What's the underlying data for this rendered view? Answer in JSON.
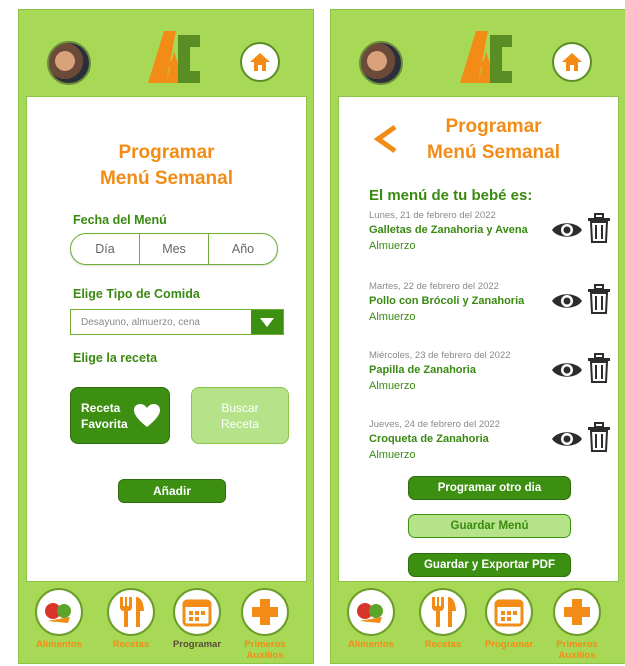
{
  "left_screen": {
    "title_line1": "Programar",
    "title_line2": "Menú Semanal",
    "date_label": "Fecha del Menú",
    "date_fields": [
      "Día",
      "Mes",
      "Año"
    ],
    "meal_type_label": "Elige Tipo de Comida",
    "meal_type_placeholder": "Desayuno, almuerzo, cena",
    "recipe_label": "Elige la receta",
    "favorite_button": "Receta Favorita",
    "search_button_line1": "Buscar",
    "search_button_line2": "Receta",
    "add_button": "Añadir"
  },
  "right_screen": {
    "title_line1": "Programar",
    "title_line2": "Menú Semanal",
    "menu_heading": "El menú de tu bebé es:",
    "meals": [
      {
        "date": "Lunes, 21 de febrero del 2022",
        "name": "Galletas de Zanahoria y Avena",
        "type": "Almuerzo"
      },
      {
        "date": "Martes, 22 de febrero del 2022",
        "name": "Pollo con Brócoli y Zanahoria",
        "type": "Almuerzo"
      },
      {
        "date": "Miércoles, 23 de febrero del 2022",
        "name": "Papilla de Zanahoria",
        "type": "Almuerzo"
      },
      {
        "date": "Jueves, 24 de febrero del 2022",
        "name": "Croqueta de Zanahoria",
        "type": "Almuerzo"
      }
    ],
    "schedule_other_button": "Programar otro dia",
    "save_menu_button": "Guardar Menú",
    "save_export_button": "Guardar y Exportar PDF"
  },
  "nav": {
    "foods": "Alimentos",
    "recipes": "Recetas",
    "schedule": "Programar",
    "first_aid_line1": "Primeros",
    "first_aid_line2": "Auxilios"
  },
  "logo_text": "AC",
  "colors": {
    "background_green": "#a8d956",
    "primary_green": "#3d8f12",
    "light_green": "#b6e28a",
    "accent_orange": "#f28c16"
  }
}
